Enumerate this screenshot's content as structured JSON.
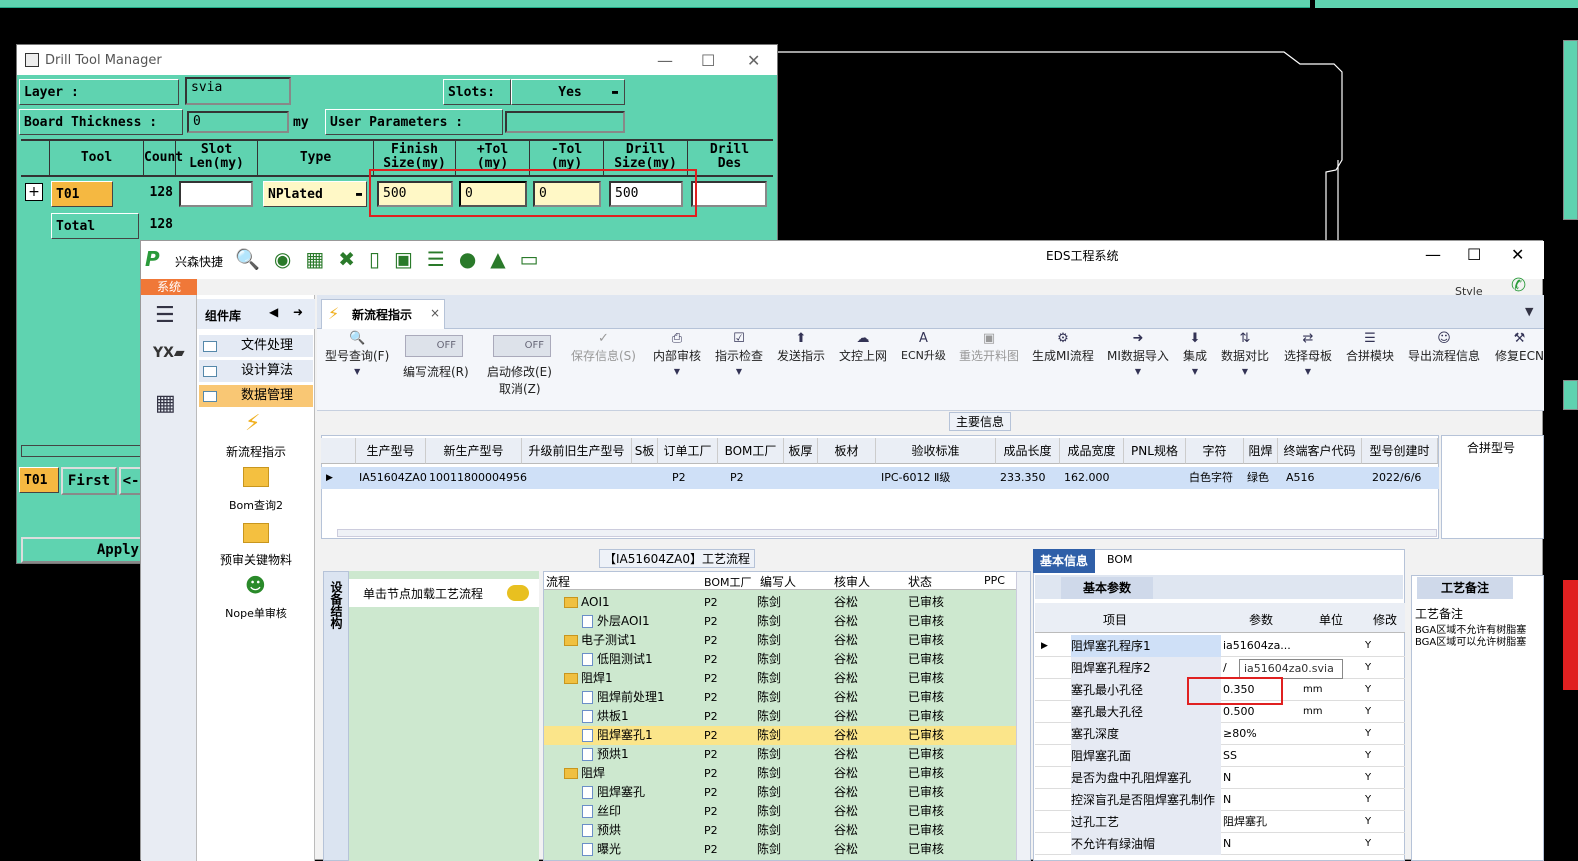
{
  "drill_tool_manager": {
    "title": "Drill Tool Manager",
    "layer_label": "Layer          :",
    "layer_value": "svia",
    "slots_label": "Slots:",
    "slots_value": "Yes",
    "board_thickness_label": "Board Thickness :",
    "board_thickness_value": "0",
    "unit": "my",
    "user_params_label": "User Parameters :",
    "headers": {
      "tool": "Tool",
      "count": "Count",
      "slot": "Slot\nLen(my)",
      "type": "Type",
      "finish": "Finish\nSize(my)",
      "ptol": "+Tol\n(my)",
      "ntol": "-Tol\n(my)",
      "drill": "Drill\nSize(my)",
      "drill_des": "Drill\nDes"
    },
    "row": {
      "tool": "T01",
      "count": "128",
      "type": "NPlated",
      "finish": "500",
      "ptol": "0",
      "ntol": "0",
      "drill": "500"
    },
    "total_label": "Total",
    "total_count": "128",
    "bottom": {
      "tool": "T01",
      "first": "First",
      "prev": "<-"
    },
    "apply": "Apply"
  },
  "eds": {
    "title": "EDS工程系统",
    "brand": "兴森快捷",
    "system_tab": "系统",
    "style_label": "Style",
    "left_panel_title": "组件库",
    "nav": [
      "文件处理",
      "设计算法",
      "数据管理"
    ],
    "components": [
      "新流程指示",
      "Bom查询2",
      "预审关键物料",
      "Nope单审核"
    ],
    "doc_tab": "新流程指示",
    "toggles": [
      "OFF",
      "OFF"
    ],
    "toolbar": [
      "型号查询(F)",
      "编写流程(R)",
      "启动修改(E)",
      "取消(Z)",
      "保存信息(S)",
      "内部审核",
      "指示检查",
      "发送指示",
      "文控上网",
      "ECN升级",
      "重选开料图",
      "生成MI流程",
      "MI数据导入",
      "集成",
      "数据对比",
      "选择母板",
      "合拼模块",
      "导出流程信息",
      "修复ECN"
    ],
    "main_info": "主要信息",
    "grid_headers": [
      "生产型号",
      "新生产型号",
      "升级前旧生产型号",
      "S板",
      "订单工厂",
      "BOM工厂",
      "板厚",
      "板材",
      "验收标准",
      "成品长度",
      "成品宽度",
      "PNL规格",
      "字符",
      "阻焊",
      "终端客户代码",
      "型号创建时"
    ],
    "grid_row": [
      "IA51604ZA0",
      "10011800004956",
      "",
      "",
      "P2",
      "P2",
      "",
      "",
      "IPC-6012 Ⅱ级",
      "233.350",
      "162.000",
      "",
      "白色字符",
      "绿色",
      "A516",
      "2022/6/6"
    ],
    "merge_header": "合拼型号",
    "process_title": "【IA51604ZA0】工艺流程",
    "side_tab": "设备结构",
    "click_hint": "单击节点加载工艺流程",
    "tree_headers": [
      "流程",
      "BOM工厂",
      "编写人",
      "核审人",
      "状态",
      "PPC"
    ],
    "tree_rows": [
      {
        "name": "AOI1",
        "folder": true,
        "bom": "P2",
        "writer": "陈剑",
        "reviewer": "谷松",
        "status": "已审核"
      },
      {
        "name": "外层AOI1",
        "folder": false,
        "bom": "P2",
        "writer": "陈剑",
        "reviewer": "谷松",
        "status": "已审核"
      },
      {
        "name": "电子测试1",
        "folder": true,
        "bom": "P2",
        "writer": "陈剑",
        "reviewer": "谷松",
        "status": "已审核"
      },
      {
        "name": "低阻测试1",
        "folder": false,
        "bom": "P2",
        "writer": "陈剑",
        "reviewer": "谷松",
        "status": "已审核"
      },
      {
        "name": "阻焊1",
        "folder": true,
        "bom": "P2",
        "writer": "陈剑",
        "reviewer": "谷松",
        "status": "已审核"
      },
      {
        "name": "阻焊前处理1",
        "folder": false,
        "bom": "P2",
        "writer": "陈剑",
        "reviewer": "谷松",
        "status": "已审核"
      },
      {
        "name": "烘板1",
        "folder": false,
        "bom": "P2",
        "writer": "陈剑",
        "reviewer": "谷松",
        "status": "已审核"
      },
      {
        "name": "阻焊塞孔1",
        "folder": false,
        "bom": "P2",
        "writer": "陈剑",
        "reviewer": "谷松",
        "status": "已审核",
        "selected": true
      },
      {
        "name": "预烘1",
        "folder": false,
        "bom": "P2",
        "writer": "陈剑",
        "reviewer": "谷松",
        "status": "已审核"
      },
      {
        "name": "阻焊",
        "folder": true,
        "bom": "P2",
        "writer": "陈剑",
        "reviewer": "谷松",
        "status": "已审核"
      },
      {
        "name": "阻焊塞孔",
        "folder": false,
        "bom": "P2",
        "writer": "陈剑",
        "reviewer": "谷松",
        "status": "已审核"
      },
      {
        "name": "丝印",
        "folder": false,
        "bom": "P2",
        "writer": "陈剑",
        "reviewer": "谷松",
        "status": "已审核"
      },
      {
        "name": "预烘",
        "folder": false,
        "bom": "P2",
        "writer": "陈剑",
        "reviewer": "谷松",
        "status": "已审核"
      },
      {
        "name": "曝光",
        "folder": false,
        "bom": "P2",
        "writer": "陈剑",
        "reviewer": "谷松",
        "status": "已审核"
      }
    ],
    "info_tabs": [
      "基本信息",
      "BOM"
    ],
    "basic_params": "基本参数",
    "param_headers": [
      "项目",
      "参数",
      "单位",
      "修改"
    ],
    "params": [
      {
        "item": "阻焊塞孔程序1",
        "value": "ia51604za...",
        "unit": "",
        "mod": "Y"
      },
      {
        "item": "阻焊塞孔程序2",
        "value": "/",
        "unit": "",
        "mod": "Y"
      },
      {
        "item": "塞孔最小孔径",
        "value": "0.350",
        "unit": "mm",
        "mod": "Y"
      },
      {
        "item": "塞孔最大孔径",
        "value": "0.500",
        "unit": "mm",
        "mod": "Y"
      },
      {
        "item": "塞孔深度",
        "value": "≥80%",
        "unit": "",
        "mod": "Y"
      },
      {
        "item": "阻焊塞孔面",
        "value": "SS",
        "unit": "",
        "mod": "Y"
      },
      {
        "item": "是否为盘中孔阻焊塞孔",
        "value": "N",
        "unit": "",
        "mod": "Y"
      },
      {
        "item": "控深盲孔是否阻焊塞孔制作",
        "value": "N",
        "unit": "",
        "mod": "Y"
      },
      {
        "item": "过孔工艺",
        "value": "阻焊塞孔",
        "unit": "",
        "mod": "Y"
      },
      {
        "item": "不允许有绿油帽",
        "value": "N",
        "unit": "",
        "mod": "Y"
      }
    ],
    "tooltip": "ia51604za0.svia",
    "remarks_title": "工艺备注",
    "remarks_label": "工艺备注",
    "remarks_text": [
      "BGA区域不允许有树脂塞",
      "BGA区域可以允许树脂塞"
    ]
  }
}
